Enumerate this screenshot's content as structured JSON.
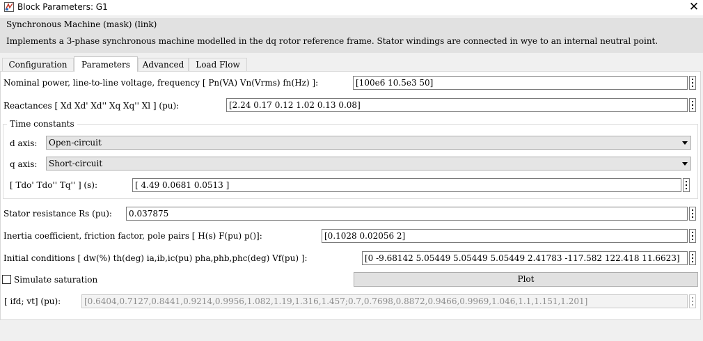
{
  "window": {
    "title": "Block Parameters: G1"
  },
  "mask": {
    "title": "Synchronous Machine (mask) (link)",
    "description": "Implements a 3-phase synchronous machine modelled in the dq rotor reference frame. Stator windings are connected in wye to an internal neutral point."
  },
  "tabs": [
    {
      "label": "Configuration"
    },
    {
      "label": "Parameters",
      "active": true
    },
    {
      "label": "Advanced"
    },
    {
      "label": "Load Flow"
    }
  ],
  "params": {
    "nominal": {
      "label": "Nominal power, line-to-line voltage, frequency [ Pn(VA)  Vn(Vrms)  fn(Hz) ]:",
      "value": "[100e6 10.5e3 50]"
    },
    "reactances": {
      "label": "Reactances [ Xd  Xd'  Xd''  Xq  Xq''  Xl ] (pu):",
      "value": "[2.24 0.17 0.12 1.02 0.13 0.08]"
    },
    "time_constants": {
      "group_title": "Time constants",
      "d_axis": {
        "label": "d axis:",
        "value": "Open-circuit"
      },
      "q_axis": {
        "label": "q axis:",
        "value": "Short-circuit"
      },
      "tau": {
        "label": "[ Tdo'  Tdo''  Tq'' ] (s):",
        "value": "[  4.49  0.0681  0.0513  ]"
      }
    },
    "stator": {
      "label": "Stator resistance Rs (pu):",
      "value": "0.037875"
    },
    "inertia": {
      "label": "Inertia coefficient, friction factor, pole pairs [ H(s)  F(pu)  p()]:",
      "value": "[0.1028 0.02056 2]"
    },
    "initial": {
      "label": "Initial conditions [ dw(%)  th(deg)  ia,ib,ic(pu)  pha,phb,phc(deg)  Vf(pu) ]:",
      "value": "[0 -9.68142 5.05449 5.05449 5.05449 2.41783 -117.582 122.418 11.6623]"
    },
    "saturation": {
      "label": "Simulate saturation",
      "checked": false
    },
    "plot_label": "Plot",
    "ifd_vt": {
      "label": "[ ifd; vt] (pu):",
      "value": "[0.6404,0.7127,0.8441,0.9214,0.9956,1.082,1.19,1.316,1.457;0.7,0.7698,0.8872,0.9466,0.9969,1.046,1.1,1.151,1.201]"
    }
  },
  "icons": {
    "window": "simulink-block-icon",
    "close": "close-icon",
    "more": "more-options-icon",
    "dropdown": "chevron-down-icon"
  }
}
